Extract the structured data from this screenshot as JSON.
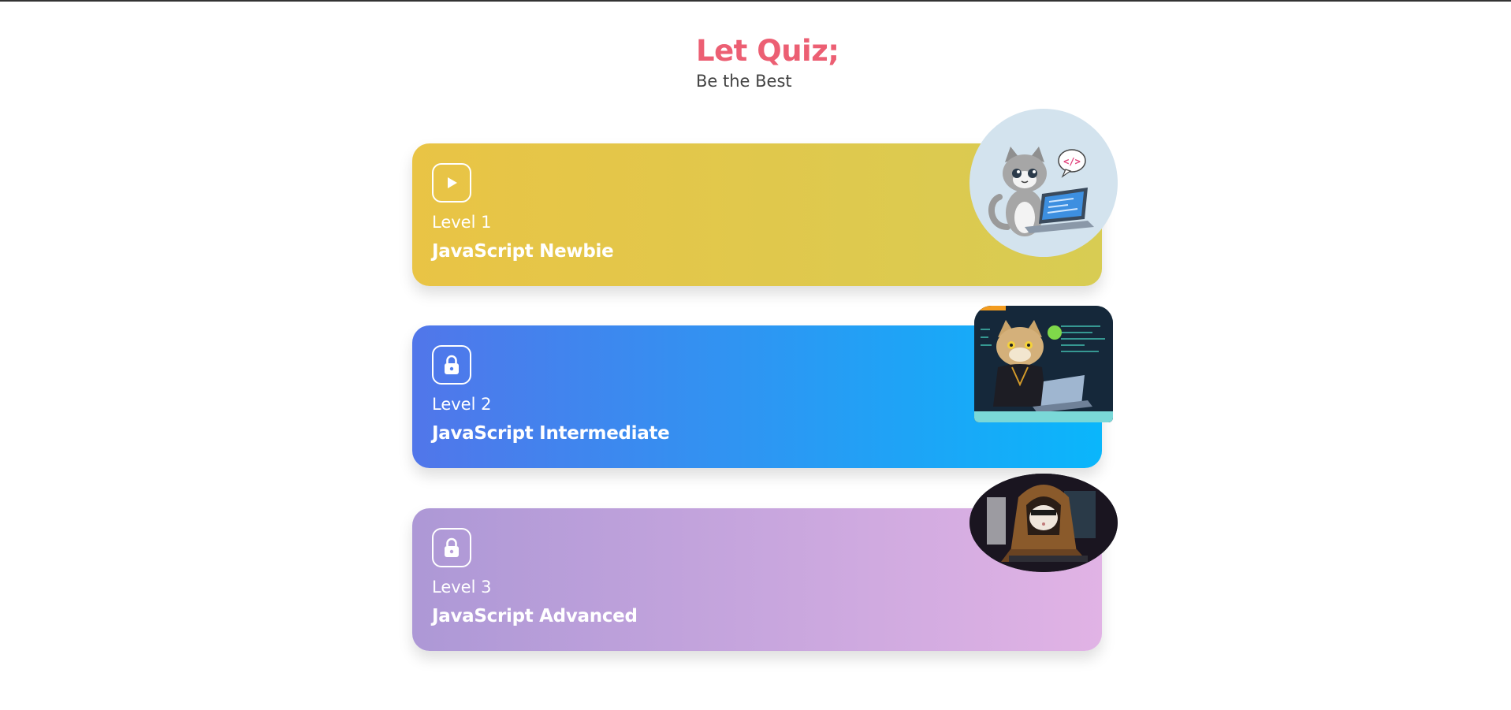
{
  "header": {
    "title": "Let Quiz;",
    "subtitle": "Be the Best"
  },
  "levels": [
    {
      "level_label": "Level 1",
      "name": "JavaScript Newbie",
      "icon": "play-icon",
      "status": "unlocked",
      "colors": {
        "start": "#e9c445",
        "end": "#d8cc53"
      }
    },
    {
      "level_label": "Level 2",
      "name": "JavaScript Intermediate",
      "icon": "lock-icon",
      "status": "locked",
      "colors": {
        "start": "#5176ea",
        "end": "#0ab6fb"
      }
    },
    {
      "level_label": "Level 3",
      "name": "JavaScript Advanced",
      "icon": "lock-icon",
      "status": "locked",
      "colors": {
        "start": "#ad98d6",
        "end": "#e1b3e5"
      }
    }
  ],
  "colors": {
    "title": "#ec5f73",
    "subtitle": "#444444"
  }
}
